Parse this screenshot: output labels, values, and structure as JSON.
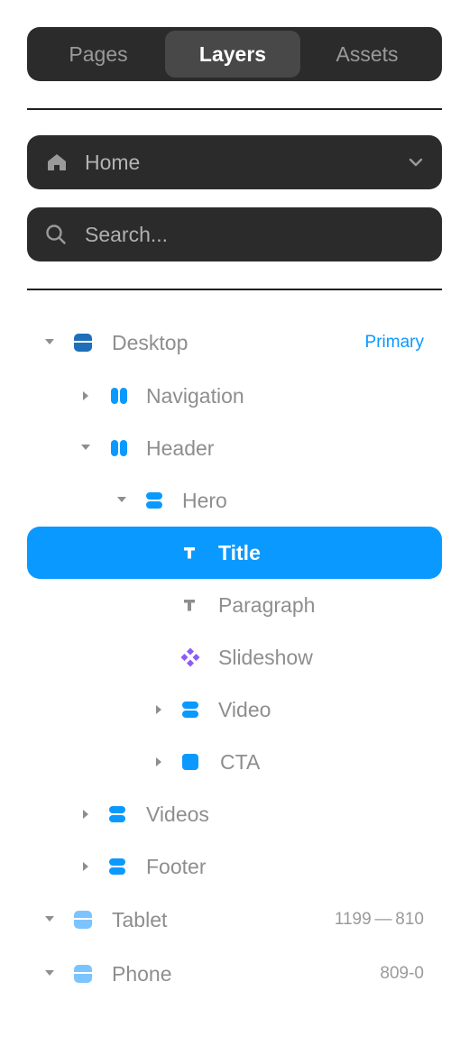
{
  "tabs": [
    {
      "label": "Pages"
    },
    {
      "label": "Layers"
    },
    {
      "label": "Assets"
    }
  ],
  "page_selector": {
    "label": "Home",
    "icon": "home-icon"
  },
  "search": {
    "placeholder": "Search..."
  },
  "layers": [
    {
      "name": "Desktop",
      "meta": "Primary"
    },
    {
      "name": "Navigation"
    },
    {
      "name": "Header"
    },
    {
      "name": "Hero"
    },
    {
      "name": "Title",
      "selected": true
    },
    {
      "name": "Paragraph"
    },
    {
      "name": "Slideshow"
    },
    {
      "name": "Video"
    },
    {
      "name": "CTA"
    },
    {
      "name": "Videos"
    },
    {
      "name": "Footer"
    },
    {
      "name": "Tablet",
      "meta": "1199 — 810"
    },
    {
      "name": "Phone",
      "meta": "809-0"
    }
  ],
  "colors": {
    "accent": "#0a99ff",
    "component": "#8b5cf6",
    "breakpoint_primary": "#1f6fb8",
    "breakpoint_light": "#7cc4ff",
    "panel_dark": "#2b2b2b"
  }
}
